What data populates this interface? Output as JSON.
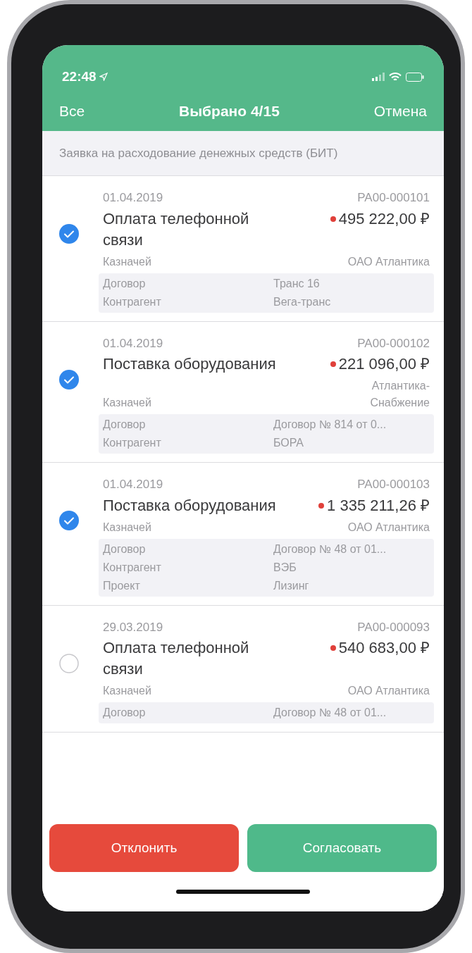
{
  "status_bar": {
    "time": "22:48"
  },
  "nav": {
    "left": "Все",
    "title": "Выбрано 4/15",
    "right": "Отмена"
  },
  "subtitle": "Заявка на расходование денежных средств (БИТ)",
  "items": [
    {
      "selected": true,
      "date": "01.04.2019",
      "number": "PA00-000101",
      "title": "Оплата телефонной связи",
      "amount": "495 222,00 ₽",
      "role_label": "Казначей",
      "role_value": "ОАО Атлантика",
      "details": [
        {
          "label": "Договор",
          "value": "Транс 16"
        },
        {
          "label": "Контрагент",
          "value": "Вега-транс"
        }
      ]
    },
    {
      "selected": true,
      "date": "01.04.2019",
      "number": "PA00-000102",
      "title": "Поставка оборудования",
      "amount": "221 096,00 ₽",
      "role_label": "Казначей",
      "role_value": "Атлантика-Снабжение",
      "details": [
        {
          "label": "Договор",
          "value": "Договор № 814 от 0..."
        },
        {
          "label": "Контрагент",
          "value": "БОРА"
        }
      ]
    },
    {
      "selected": true,
      "date": "01.04.2019",
      "number": "PA00-000103",
      "title": "Поставка оборудования",
      "amount": "1 335 211,26 ₽",
      "role_label": "Казначей",
      "role_value": "ОАО Атлантика",
      "details": [
        {
          "label": "Договор",
          "value": "Договор № 48 от 01..."
        },
        {
          "label": "Контрагент",
          "value": "ВЭБ"
        },
        {
          "label": "Проект",
          "value": "Лизинг"
        }
      ]
    },
    {
      "selected": false,
      "date": "29.03.2019",
      "number": "PA00-000093",
      "title": "Оплата телефонной связи",
      "amount": "540 683,00 ₽",
      "role_label": "Казначей",
      "role_value": "ОАО Атлантика",
      "details": [
        {
          "label": "Договор",
          "value": "Договор № 48 от 01..."
        }
      ]
    }
  ],
  "buttons": {
    "reject": "Отклонить",
    "approve": "Согласовать"
  }
}
